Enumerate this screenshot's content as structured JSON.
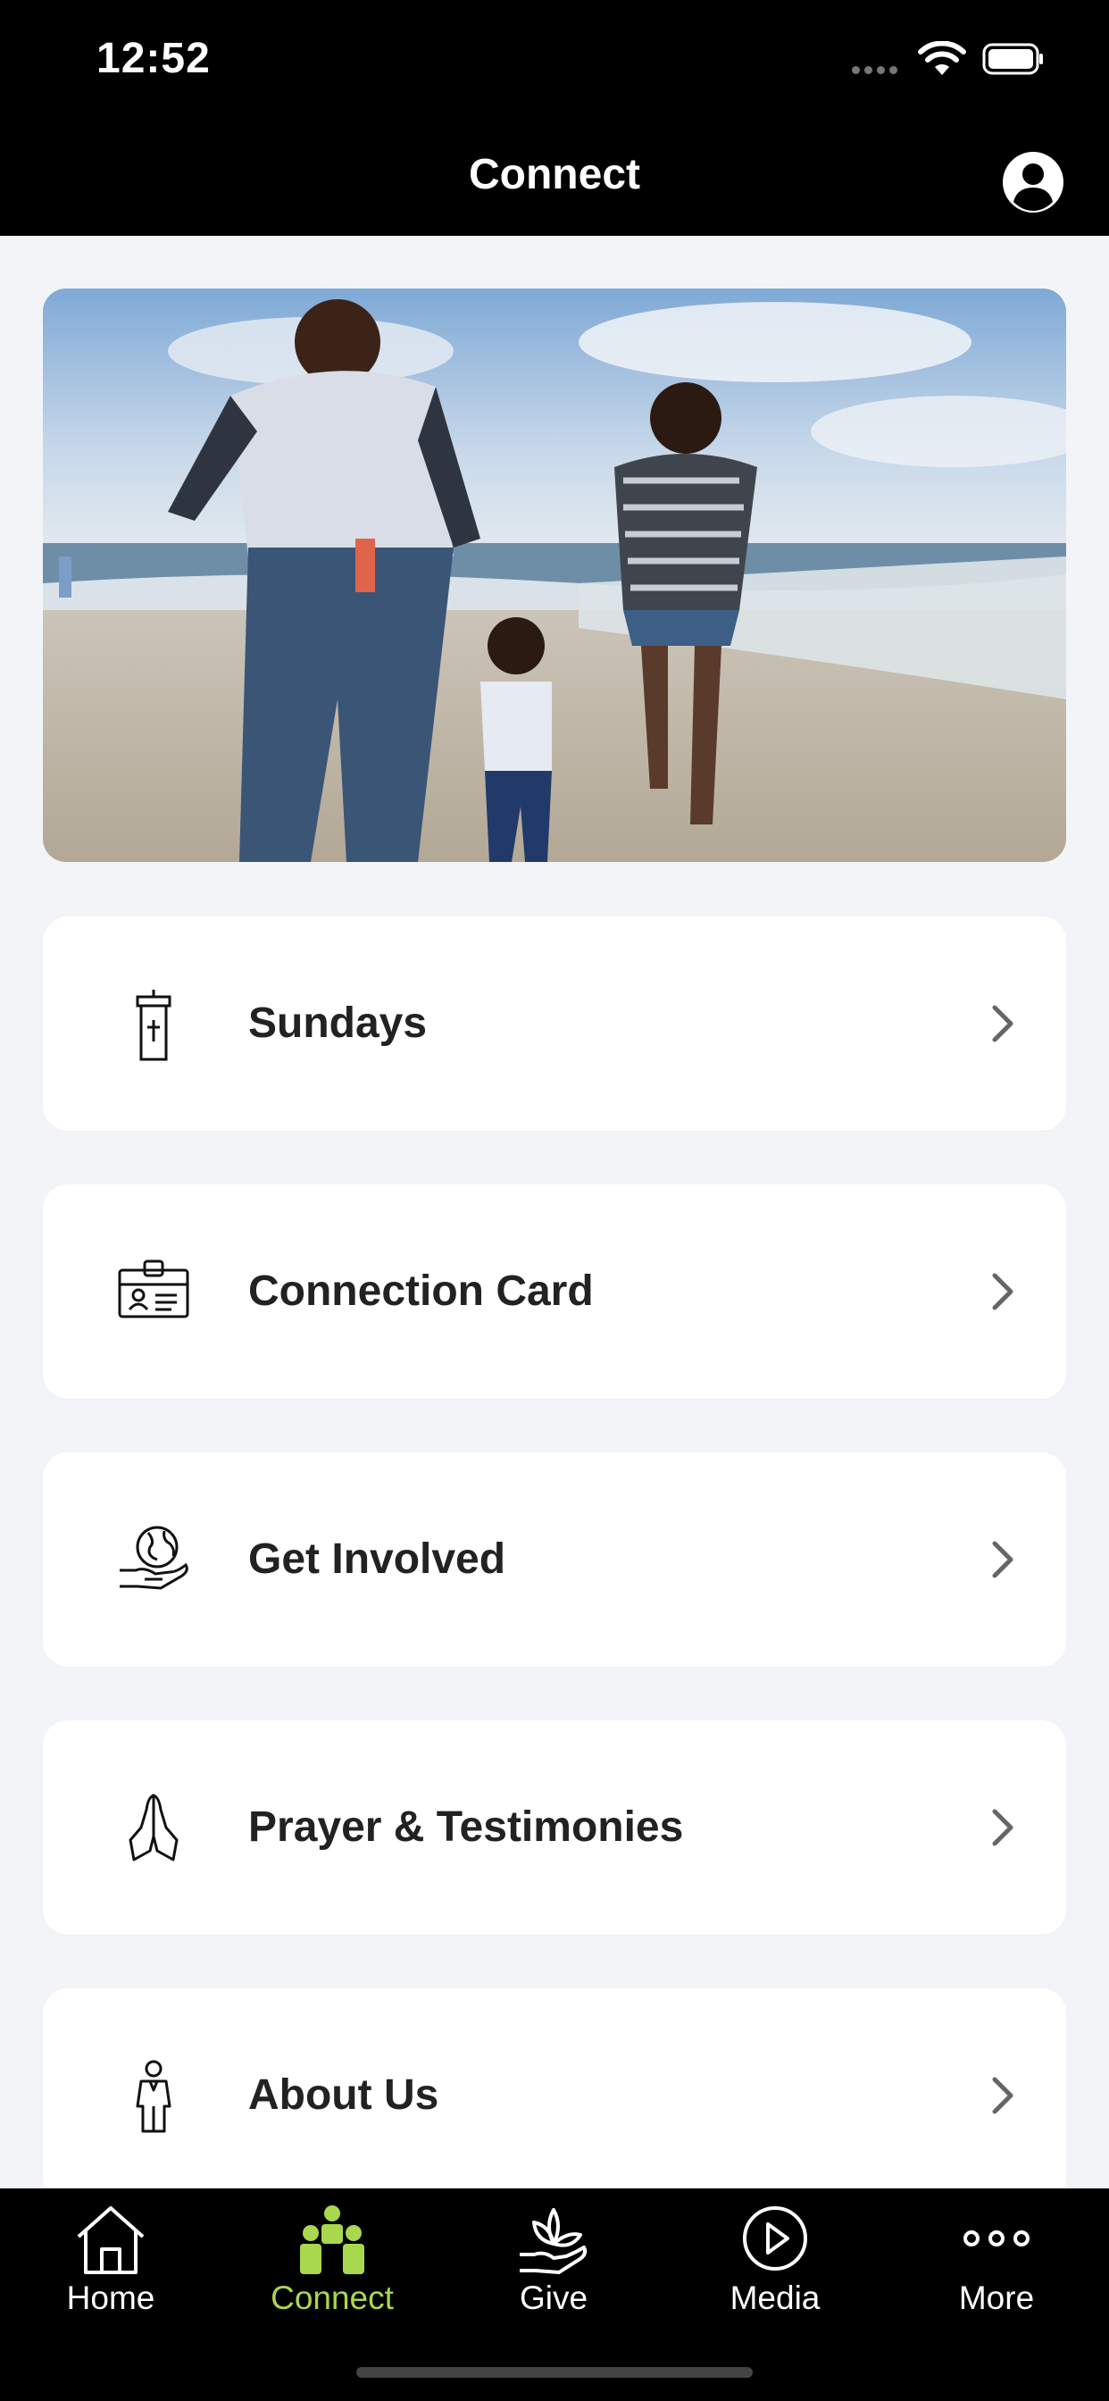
{
  "status_bar": {
    "time": "12:52"
  },
  "nav": {
    "title": "Connect"
  },
  "menu_items": [
    {
      "label": "Sundays",
      "icon": "pulpit-icon"
    },
    {
      "label": "Connection Card",
      "icon": "id-badge-icon"
    },
    {
      "label": "Get Involved",
      "icon": "globe-hand-icon"
    },
    {
      "label": "Prayer & Testimonies",
      "icon": "praying-hands-icon"
    },
    {
      "label": "About Us",
      "icon": "person-icon"
    }
  ],
  "tabs": [
    {
      "label": "Home",
      "icon": "home-icon"
    },
    {
      "label": "Connect",
      "icon": "people-icon",
      "active": true
    },
    {
      "label": "Give",
      "icon": "give-icon"
    },
    {
      "label": "Media",
      "icon": "play-circle-icon"
    },
    {
      "label": "More",
      "icon": "more-dots-icon"
    }
  ],
  "colors": {
    "accent": "#a8d84e",
    "background": "#f2f4f8",
    "bar": "#000000"
  }
}
